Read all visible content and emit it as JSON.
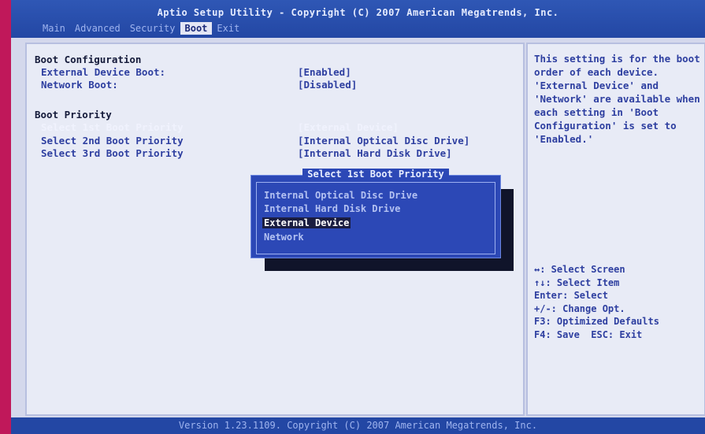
{
  "header": {
    "title": "Aptio Setup Utility - Copyright (C) 2007 American Megatrends, Inc.",
    "tabs": [
      "Main",
      "Advanced",
      "Security",
      "Boot",
      "Exit"
    ],
    "active_tab": "Boot"
  },
  "main": {
    "boot_config": {
      "heading": "Boot Configuration",
      "external_label": "External Device Boot:",
      "external_value": "[Enabled]",
      "network_label": "Network Boot:",
      "network_value": "[Disabled]"
    },
    "boot_priority": {
      "heading": "Boot Priority",
      "items": [
        {
          "label": "Select 1st Boot Priority",
          "value": "[External Device]"
        },
        {
          "label": "Select 2nd Boot Priority",
          "value": "[Internal Optical Disc Drive]"
        },
        {
          "label": "Select 3rd Boot Priority",
          "value": "[Internal Hard Disk Drive]"
        }
      ]
    }
  },
  "popup": {
    "title": "Select 1st Boot Priority",
    "options": [
      "Internal Optical Disc Drive",
      "Internal Hard Disk Drive",
      "External Device",
      "Network"
    ],
    "selected": "External Device"
  },
  "help": {
    "text": "This setting is for the boot order of each device. 'External Device' and 'Network' are available when each setting in 'Boot Configuration' is set to 'Enabled.'",
    "keys": [
      "↔: Select Screen",
      "↑↓: Select Item",
      "Enter: Select",
      "+/-: Change Opt.",
      "F3: Optimized Defaults",
      "F4: Save  ESC: Exit"
    ]
  },
  "footer": "Version 1.23.1109. Copyright (C) 2007 American Megatrends, Inc."
}
